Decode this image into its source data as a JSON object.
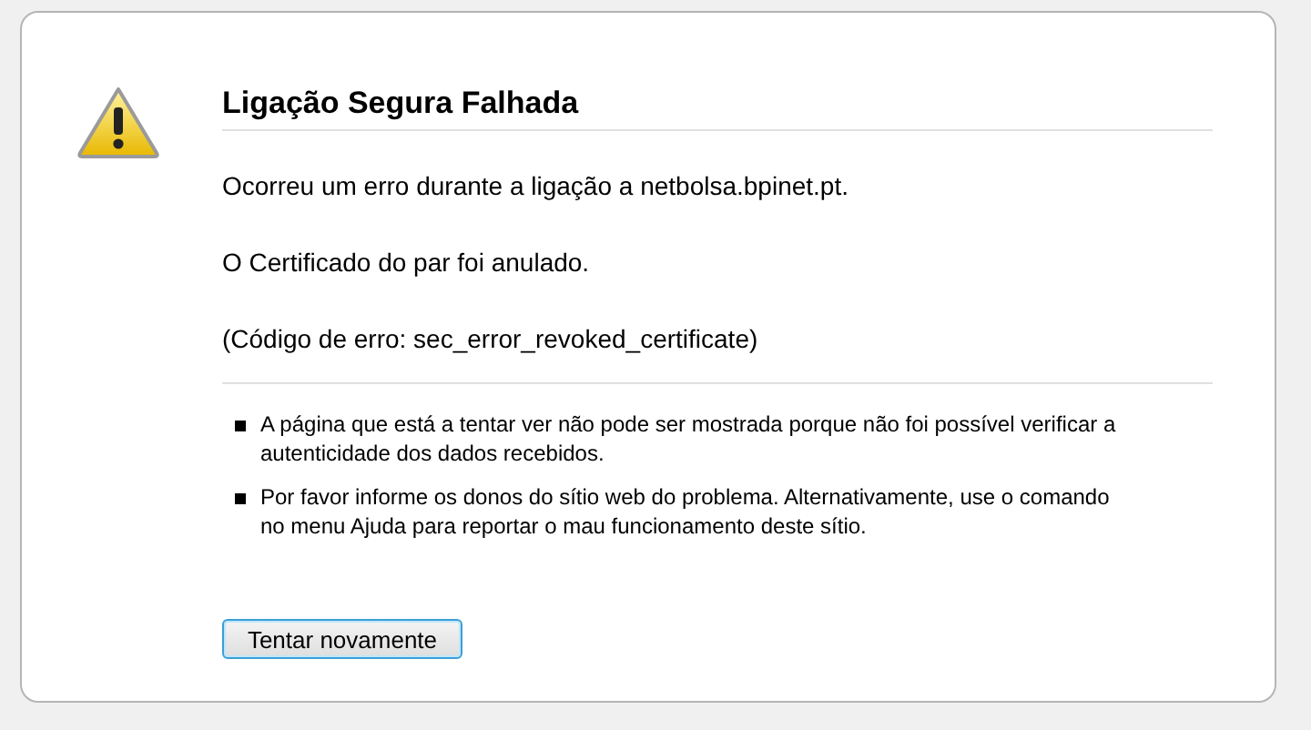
{
  "title": "Ligação Segura Falhada",
  "paragraphs": [
    "Ocorreu um erro durante a ligação a netbolsa.bpinet.pt.",
    "O Certificado do par foi anulado.",
    "(Código de erro: sec_error_revoked_certificate)"
  ],
  "bullets": [
    "A página que está a tentar ver não pode ser mostrada porque não foi possível verificar a autenticidade dos dados recebidos.",
    "Por favor informe os donos do sítio web do problema. Alternativamente, use o comando no menu Ajuda para reportar o mau funcionamento deste sítio."
  ],
  "button": "Tentar novamente"
}
